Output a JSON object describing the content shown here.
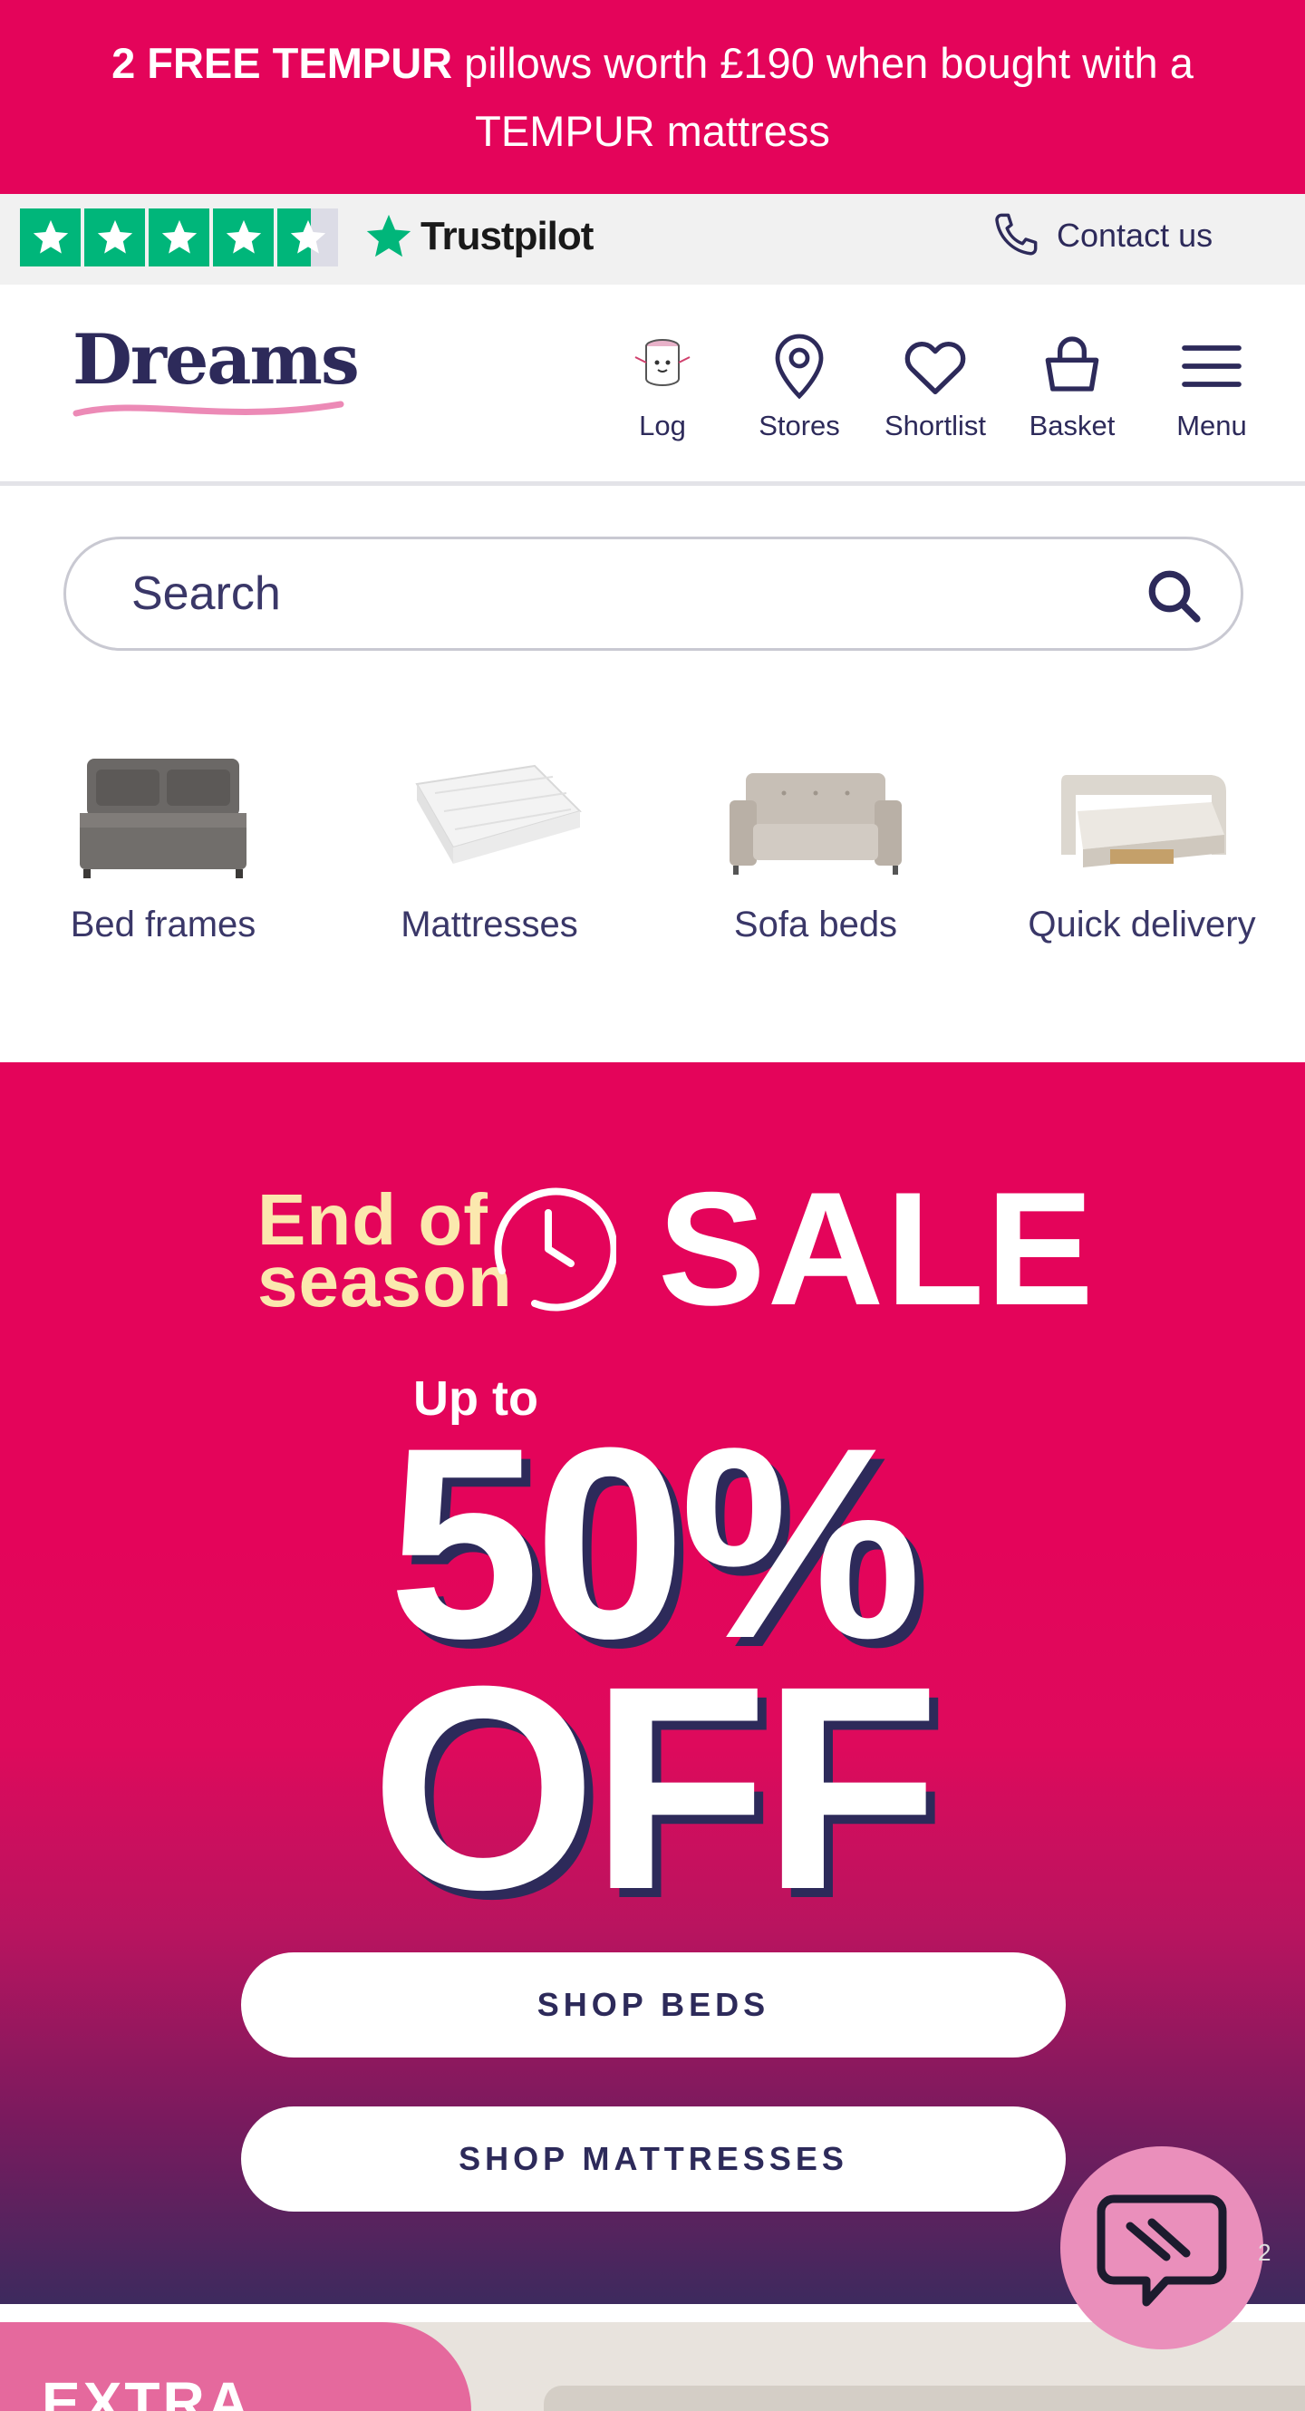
{
  "promo": {
    "bold": "2 FREE TEMPUR",
    "rest": " pillows worth £190 when bought with a TEMPUR mattress"
  },
  "trust": {
    "brand": "Trustpilot",
    "rating_stars": 4.5,
    "contact_label": "Contact us"
  },
  "header": {
    "logo": "Dreams",
    "nav": [
      {
        "label": "Log",
        "icon": "log-mascot-icon"
      },
      {
        "label": "Stores",
        "icon": "map-pin-icon"
      },
      {
        "label": "Shortlist",
        "icon": "heart-icon"
      },
      {
        "label": "Basket",
        "icon": "basket-icon"
      },
      {
        "label": "Menu",
        "icon": "hamburger-icon"
      }
    ]
  },
  "search": {
    "placeholder": "Search"
  },
  "categories": [
    {
      "label": "Bed frames"
    },
    {
      "label": "Mattresses"
    },
    {
      "label": "Sofa beds"
    },
    {
      "label": "Quick delivery"
    }
  ],
  "hero": {
    "eos_line1": "End of",
    "eos_line2": "season",
    "sale": "SALE",
    "up_to": "Up to",
    "percent": "50%",
    "off": "OFF",
    "cta_beds": "SHOP BEDS",
    "cta_mattresses": "SHOP MATTRESSES"
  },
  "bottom": {
    "teaser": "EXTRA"
  },
  "chat": {
    "badge": "2"
  },
  "colors": {
    "brand_pink": "#e4045a",
    "navy": "#2d2a5a",
    "trustpilot_green": "#00b67a",
    "cream": "#fbe8ae",
    "chat_pink": "#ea8fbb"
  }
}
